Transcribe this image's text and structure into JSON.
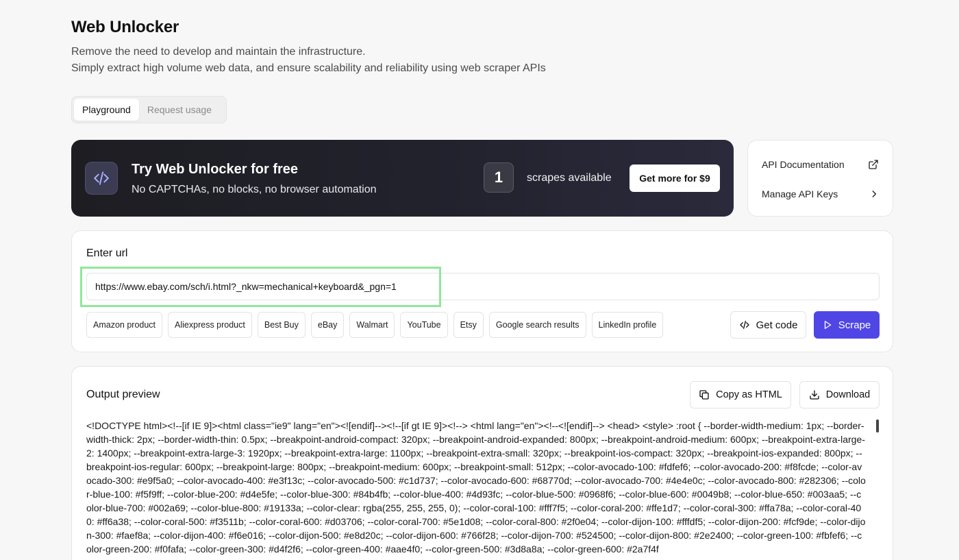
{
  "header": {
    "title": "Web Unlocker",
    "subtitle_line1": "Remove the need to develop and maintain the infrastructure.",
    "subtitle_line2": "Simply extract high volume web data, and ensure scalability and reliability using web scraper APIs"
  },
  "tabs": [
    {
      "label": "Playground",
      "active": true
    },
    {
      "label": "Request usage",
      "active": false
    }
  ],
  "banner": {
    "title": "Try Web Unlocker for free",
    "subtitle": "No CAPTCHAs, no blocks, no browser automation",
    "count": "1",
    "count_label": "scrapes available",
    "cta_label": "Get more for $9",
    "icon": "code-icon"
  },
  "side_links": [
    {
      "label": "API Documentation",
      "icon": "external-link-icon"
    },
    {
      "label": "Manage API Keys",
      "icon": "chevron-right-icon"
    }
  ],
  "url_section": {
    "label": "Enter url",
    "url_value": "https://www.ebay.com/sch/i.html?_nkw=mechanical+keyboard&_pgn=1",
    "presets": [
      "Amazon product",
      "Aliexpress product",
      "Best Buy",
      "eBay",
      "Walmart",
      "YouTube",
      "Etsy",
      "Google search results",
      "LinkedIn profile"
    ],
    "get_code_label": "Get code",
    "scrape_label": "Scrape",
    "accent_color": "#5046e5",
    "highlight_color": "#8fe79a"
  },
  "output": {
    "label": "Output preview",
    "copy_label": "Copy as HTML",
    "download_label": "Download",
    "text": "<!DOCTYPE html><!--[if IE 9]><html class=\"ie9\" lang=\"en\"><![endif]--><!--[if gt IE 9]><!--> <html lang=\"en\"><!--<![endif]--> <head> <style> :root { --border-width-medium: 1px; --border-width-thick: 2px; --border-width-thin: 0.5px; --breakpoint-android-compact: 320px; --breakpoint-android-expanded: 800px; --breakpoint-android-medium: 600px; --breakpoint-extra-large-2: 1400px; --breakpoint-extra-large-3: 1920px; --breakpoint-extra-large: 1100px; --breakpoint-extra-small: 320px; --breakpoint-ios-compact: 320px; --breakpoint-ios-expanded: 800px; --breakpoint-ios-regular: 600px; --breakpoint-large: 800px; --breakpoint-medium: 600px; --breakpoint-small: 512px; --color-avocado-100: #fdfef6; --color-avocado-200: #f8fcde; --color-avocado-300: #e9f5a0; --color-avocado-400: #e3f13c; --color-avocado-500: #c1d737; --color-avocado-600: #68770d; --color-avocado-700: #4e4e0c; --color-avocado-800: #282306; --color-blue-100: #f5f9ff; --color-blue-200: #d4e5fe; --color-blue-300: #84b4fb; --color-blue-400: #4d93fc; --color-blue-500: #0968f6; --color-blue-600: #0049b8; --color-blue-650: #003aa5; --color-blue-700: #002a69; --color-blue-800: #19133a; --color-clear: rgba(255, 255, 255, 0); --color-coral-100: #fff7f5; --color-coral-200: #ffe1d7; --color-coral-300: #ffa78a; --color-coral-400: #ff6a38; --color-coral-500: #f3511b; --color-coral-600: #d03706; --color-coral-700: #5e1d08; --color-coral-800: #2f0e04; --color-dijon-100: #fffdf5; --color-dijon-200: #fcf9de; --color-dijon-300: #faef8a; --color-dijon-400: #f6e016; --color-dijon-500: #e8d20c; --color-dijon-600: #766f28; --color-dijon-700: #524500; --color-dijon-800: #2e2400; --color-green-100: #fbfef6; --color-green-200: #f0fafa; --color-green-300: #d4f2f6; --color-green-400: #aae4f0; --color-green-500: #3d8a8a; --color-green-600: #2a7f4f"
  }
}
